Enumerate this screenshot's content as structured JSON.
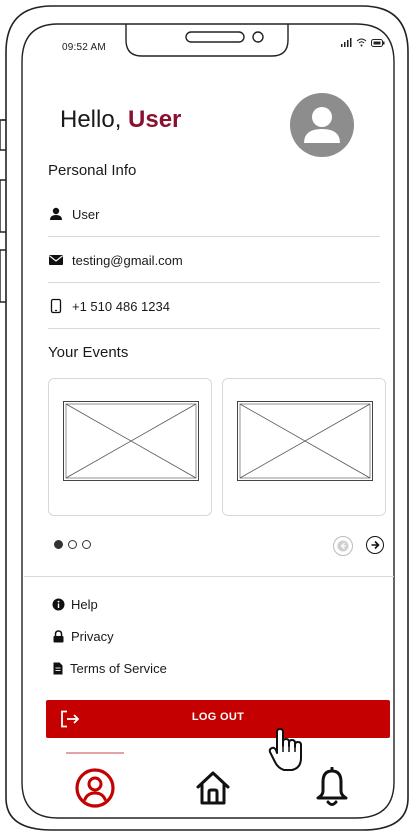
{
  "status_bar": {
    "time": "09:52 AM"
  },
  "header": {
    "greeting": "Hello,",
    "user_name": "User"
  },
  "personal_info": {
    "title": "Personal Info",
    "name": "User",
    "email": "testing@gmail.com",
    "phone": "+1 510 486 1234"
  },
  "events": {
    "title": "Your Events",
    "carousel_page": 1,
    "carousel_total": 3
  },
  "links": {
    "help": "Help",
    "privacy": "Privacy",
    "terms": "Terms of Service"
  },
  "logout": {
    "label": "LOG OUT"
  },
  "bottom_nav": {
    "items": [
      "profile-icon",
      "home-icon",
      "bell-icon"
    ],
    "active": "profile"
  },
  "colors": {
    "accent": "#c40000",
    "user_name": "#8a1030",
    "avatar": "#8d8d8d"
  }
}
